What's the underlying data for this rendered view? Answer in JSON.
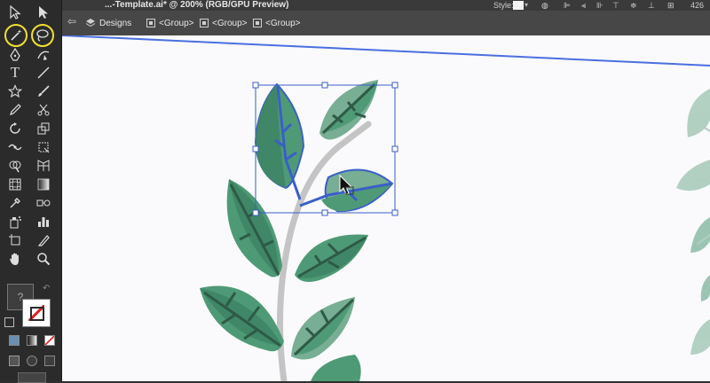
{
  "document": {
    "title": "...-Template.ai* @ 200% (RGB/GPU Preview)"
  },
  "control_bar": {
    "style_label": "Style:",
    "zoom_partial": "426"
  },
  "breadcrumb": {
    "items": [
      {
        "label": "Designs"
      },
      {
        "label": "<Group>"
      },
      {
        "label": "<Group>"
      },
      {
        "label": "<Group>"
      }
    ]
  },
  "toolbar": {
    "highlighted_tools": [
      "magic-wand-tool",
      "lasso-tool"
    ]
  },
  "colors": {
    "leaf_dark": "#3f8766",
    "leaf_mid": "#4f9a76",
    "leaf_light": "#78ae93",
    "stem": "#c4c4c4",
    "vein": "#2e5a46",
    "selection": "#3a5fc8",
    "highlight_ring": "#f1e033"
  }
}
